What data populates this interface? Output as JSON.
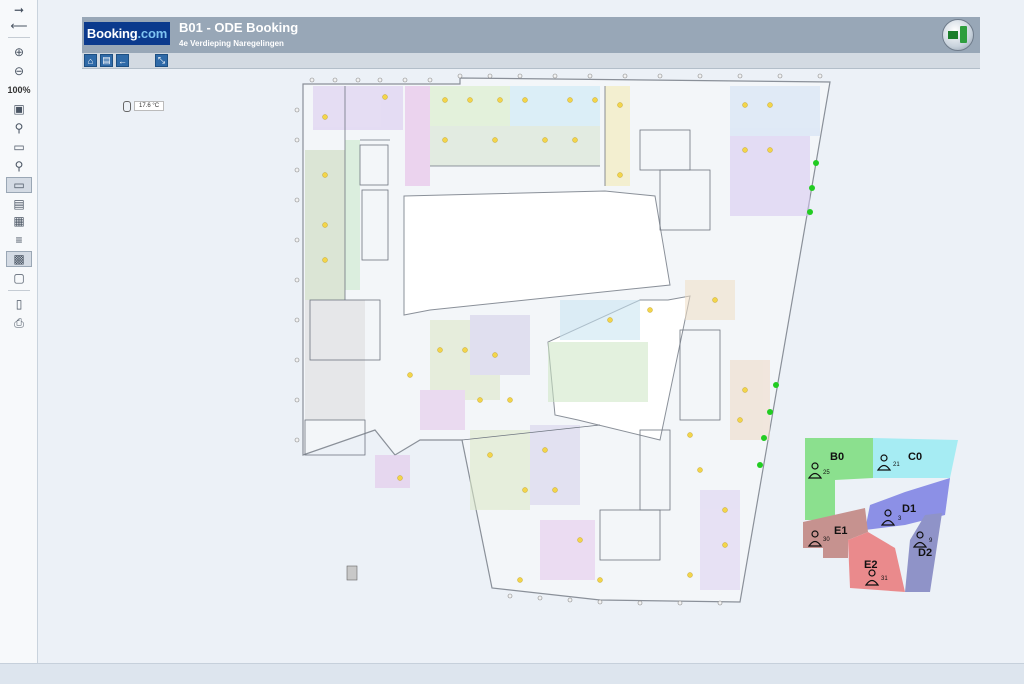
{
  "header": {
    "logo_text": "Booking",
    "logo_dot": ".com",
    "title": "B01 - ODE Booking",
    "subtitle": "4e Verdieping Naregelingen"
  },
  "toolbar": {
    "zoom_level": "100%",
    "icons": [
      "arrow-right-icon",
      "arrow-left-icon",
      "zoom-in-icon",
      "zoom-out-icon",
      "zoom-100-label",
      "fit-page-icon",
      "zoom-search-icon",
      "window-icon",
      "zoom-area-icon",
      "fullscreen-icon",
      "layer-icon",
      "layer-alt-icon",
      "list-icon",
      "monitor-icon",
      "monitor-alt-icon",
      "page-icon",
      "print-icon"
    ]
  },
  "temperature": {
    "value": "17.6 °C"
  },
  "legend": {
    "zones": [
      {
        "name": "B0",
        "count": "25",
        "color": "#8be08e"
      },
      {
        "name": "C0",
        "count": "21",
        "color": "#a6ecf3"
      },
      {
        "name": "D1",
        "count": "3",
        "color": "#8c90e6"
      },
      {
        "name": "D2",
        "count": "9",
        "color": "#8f93c8"
      },
      {
        "name": "E1",
        "count": "30",
        "color": "#c6928f"
      },
      {
        "name": "E2",
        "count": "31",
        "color": "#ea8a8c"
      }
    ]
  },
  "colors": {
    "header_bg": "#98a7b7",
    "logo_bg": "#0b3a8d",
    "sensor_green": "#22cc22"
  }
}
